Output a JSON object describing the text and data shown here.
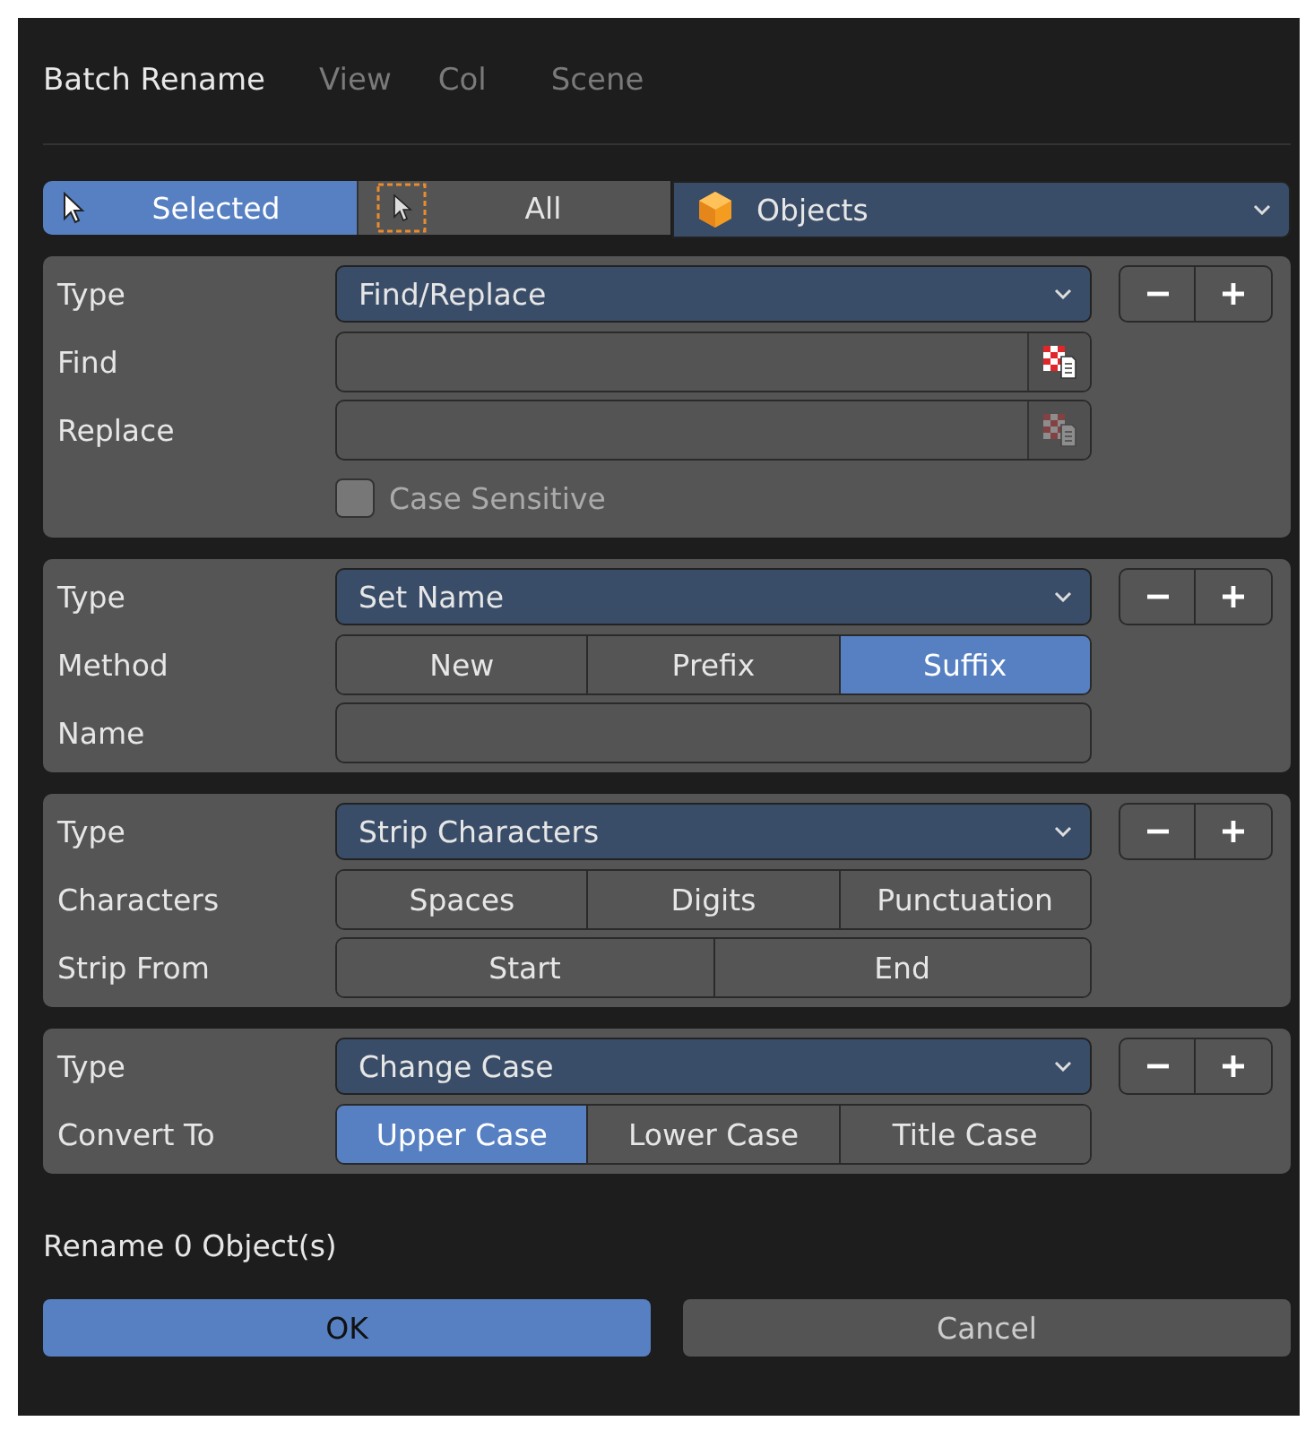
{
  "dialog": {
    "title": "Batch Rename"
  },
  "backdrop": {
    "menu_items": [
      "View",
      "Col"
    ],
    "tree_item": "Scene"
  },
  "scope": {
    "options": [
      {
        "label": "Selected",
        "kind": "arrow",
        "selected": true
      },
      {
        "label": "All",
        "kind": "arrow-box",
        "selected": false
      }
    ],
    "data_type": "Objects"
  },
  "operations": [
    {
      "rows": [
        {
          "kind": "dropdown",
          "label": "Type",
          "value": "Find/Replace"
        },
        {
          "kind": "field",
          "label": "Find",
          "disabled": false
        },
        {
          "kind": "field",
          "label": "Replace",
          "disabled": true
        },
        {
          "kind": "checkbox",
          "text": "Case Sensitive",
          "checked": false
        }
      ]
    },
    {
      "rows": [
        {
          "kind": "dropdown",
          "label": "Type",
          "value": "Set Name"
        },
        {
          "kind": "segmented",
          "label": "Method",
          "options": [
            {
              "label": "New",
              "selected": false
            },
            {
              "label": "Prefix",
              "selected": false
            },
            {
              "label": "Suffix",
              "selected": true
            }
          ]
        },
        {
          "kind": "text",
          "label": "Name"
        }
      ]
    },
    {
      "rows": [
        {
          "kind": "dropdown",
          "label": "Type",
          "value": "Strip Characters"
        },
        {
          "kind": "segmented",
          "label": "Characters",
          "options": [
            {
              "label": "Spaces",
              "selected": false
            },
            {
              "label": "Digits",
              "selected": false
            },
            {
              "label": "Punctuation",
              "selected": false
            }
          ]
        },
        {
          "kind": "segmented",
          "label": "Strip From",
          "options": [
            {
              "label": "Start",
              "selected": false
            },
            {
              "label": "End",
              "selected": false
            }
          ]
        }
      ]
    },
    {
      "rows": [
        {
          "kind": "dropdown",
          "label": "Type",
          "value": "Change Case"
        },
        {
          "kind": "segmented",
          "label": "Convert To",
          "options": [
            {
              "label": "Upper Case",
              "selected": true
            },
            {
              "label": "Lower Case",
              "selected": false
            },
            {
              "label": "Title Case",
              "selected": false
            }
          ]
        }
      ]
    }
  ],
  "status": "Rename 0 Object(s)",
  "buttons": [
    {
      "label": "OK",
      "kind": "primary"
    },
    {
      "label": "Cancel",
      "kind": "secondary"
    }
  ]
}
